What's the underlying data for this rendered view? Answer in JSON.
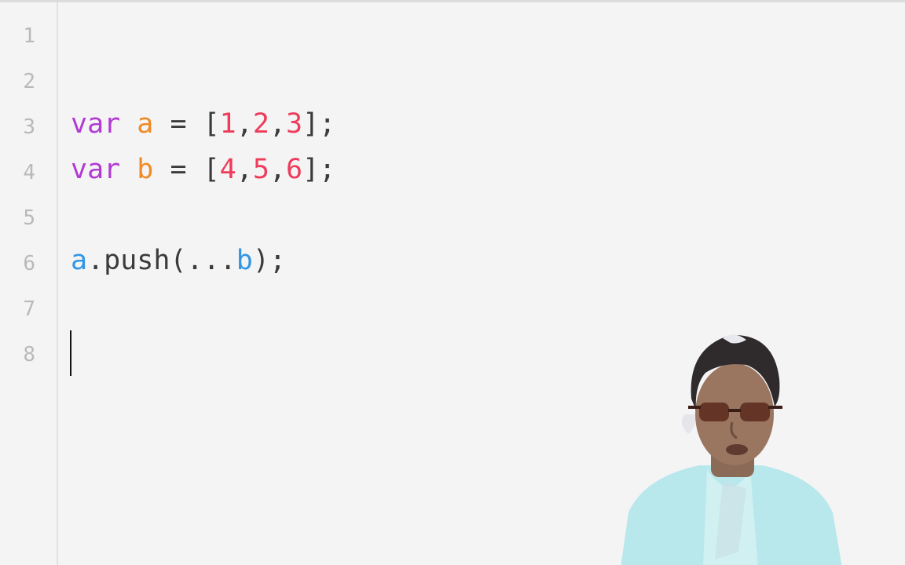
{
  "editor": {
    "line_numbers": [
      "1",
      "2",
      "3",
      "4",
      "5",
      "6",
      "7",
      "8"
    ],
    "lines": [
      {
        "tokens": []
      },
      {
        "tokens": []
      },
      {
        "tokens": [
          {
            "text": "var",
            "kind": "keyword"
          },
          {
            "text": " ",
            "kind": "space"
          },
          {
            "text": "a",
            "kind": "variable-orange"
          },
          {
            "text": " = [",
            "kind": "punct"
          },
          {
            "text": "1",
            "kind": "number"
          },
          {
            "text": ",",
            "kind": "punct"
          },
          {
            "text": "2",
            "kind": "number"
          },
          {
            "text": ",",
            "kind": "punct"
          },
          {
            "text": "3",
            "kind": "number"
          },
          {
            "text": "];",
            "kind": "punct"
          }
        ]
      },
      {
        "tokens": [
          {
            "text": "var",
            "kind": "keyword"
          },
          {
            "text": " ",
            "kind": "space"
          },
          {
            "text": "b",
            "kind": "variable-orange"
          },
          {
            "text": " = [",
            "kind": "punct"
          },
          {
            "text": "4",
            "kind": "number"
          },
          {
            "text": ",",
            "kind": "punct"
          },
          {
            "text": "5",
            "kind": "number"
          },
          {
            "text": ",",
            "kind": "punct"
          },
          {
            "text": "6",
            "kind": "number"
          },
          {
            "text": "];",
            "kind": "punct"
          }
        ]
      },
      {
        "tokens": []
      },
      {
        "tokens": [
          {
            "text": "a",
            "kind": "variable-blue"
          },
          {
            "text": ".push(...",
            "kind": "punct"
          },
          {
            "text": "b",
            "kind": "variable-blue"
          },
          {
            "text": ");",
            "kind": "punct"
          }
        ]
      },
      {
        "tokens": []
      },
      {
        "tokens": []
      }
    ],
    "cursor_line": 8,
    "colors": {
      "keyword": "#b33ad4",
      "variable_orange": "#ef8b26",
      "number": "#ee3c5b",
      "variable_blue": "#3296e6",
      "punct": "#3b3b3b",
      "line_number": "#b9b9b9",
      "background": "#f4f4f4"
    }
  },
  "webcam_overlay": {
    "icon": "presenter-webcam-icon"
  }
}
